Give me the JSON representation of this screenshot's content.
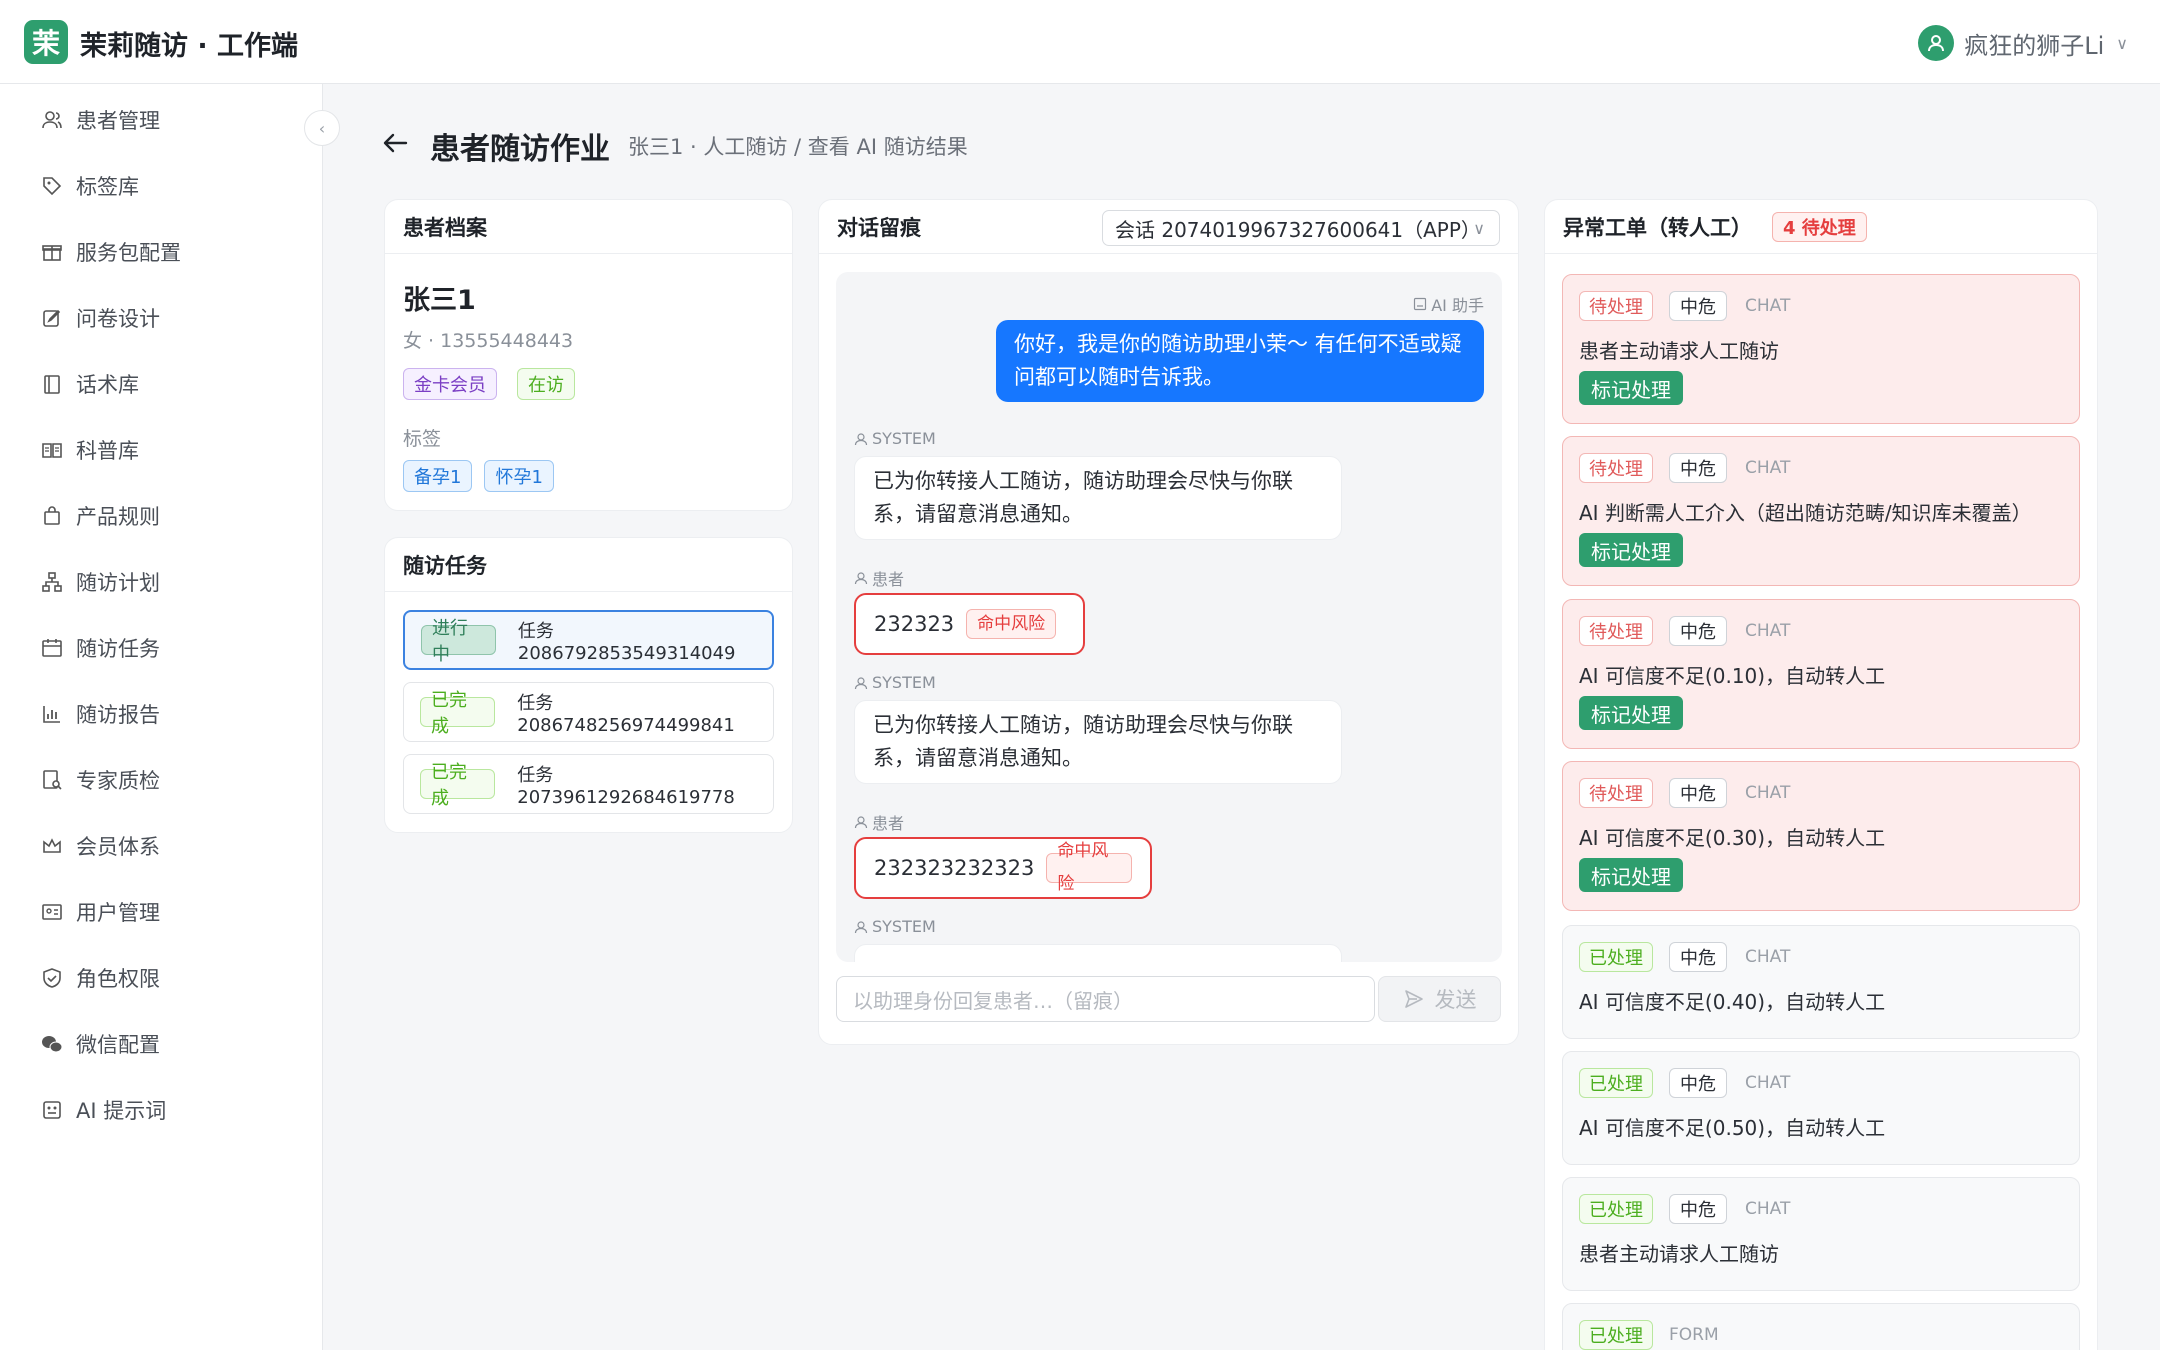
{
  "app": {
    "logo_char": "茉",
    "title": "茉莉随访 · 工作端",
    "user_name": "疯狂的狮子Li",
    "brand_color": "#2e9e6e"
  },
  "sidebar": {
    "items": [
      {
        "label": "患者管理",
        "icon": "users-icon"
      },
      {
        "label": "标签库",
        "icon": "tag-icon"
      },
      {
        "label": "服务包配置",
        "icon": "gift-icon"
      },
      {
        "label": "问卷设计",
        "icon": "edit-icon"
      },
      {
        "label": "话术库",
        "icon": "book-icon"
      },
      {
        "label": "科普库",
        "icon": "open-book-icon"
      },
      {
        "label": "产品规则",
        "icon": "bag-icon"
      },
      {
        "label": "随访计划",
        "icon": "org-chart-icon"
      },
      {
        "label": "随访任务",
        "icon": "calendar-icon"
      },
      {
        "label": "随访报告",
        "icon": "bar-chart-icon"
      },
      {
        "label": "专家质检",
        "icon": "audit-icon"
      },
      {
        "label": "会员体系",
        "icon": "crown-icon"
      },
      {
        "label": "用户管理",
        "icon": "id-card-icon"
      },
      {
        "label": "角色权限",
        "icon": "shield-icon"
      },
      {
        "label": "微信配置",
        "icon": "wechat-icon"
      },
      {
        "label": "AI 提示词",
        "icon": "robot-icon"
      }
    ]
  },
  "page": {
    "title": "患者随访作业",
    "breadcrumb": "张三1 · 人工随访 / 查看 AI 随访结果"
  },
  "patient": {
    "section_title": "患者档案",
    "name": "张三1",
    "info": "女 · 13555448443",
    "badges": [
      "金卡会员",
      "在访"
    ],
    "tags_label": "标签",
    "tags": [
      "备孕1",
      "怀孕1"
    ]
  },
  "tasks": {
    "section_title": "随访任务",
    "items": [
      {
        "status": "进行中",
        "name": "任务 2086792853549314049",
        "active": true
      },
      {
        "status": "已完成",
        "name": "任务 2086748256974499841",
        "active": false
      },
      {
        "status": "已完成",
        "name": "任务 2073961292684619778",
        "active": false
      }
    ]
  },
  "chat": {
    "section_title": "对话留痕",
    "session": "会话 2074019967327600641（APP）",
    "messages": [
      {
        "sender": "AI 助手",
        "type": "ai",
        "text1": "你好，我是你的随访助理小茉～ 有任何不适或疑",
        "text2": "问都可以随时告诉我。"
      },
      {
        "sender": "SYSTEM",
        "type": "system",
        "text1": "已为你转接人工随访，随访助理会尽快与你联",
        "text2": "系，请留意消息通知。"
      },
      {
        "sender": "患者",
        "type": "patient",
        "text": "232323",
        "risk": "命中风险"
      },
      {
        "sender": "SYSTEM",
        "type": "system",
        "text1": "已为你转接人工随访，随访助理会尽快与你联",
        "text2": "系，请留意消息通知。"
      },
      {
        "sender": "患者",
        "type": "patient",
        "text": "232323232323",
        "risk": "命中风险"
      },
      {
        "sender": "SYSTEM",
        "type": "system",
        "text1": "",
        "text2": ""
      }
    ],
    "input_placeholder": "以助理身份回复患者…（留痕）",
    "send_label": "发送"
  },
  "tickets": {
    "section_title": "异常工单（转人工）",
    "pending_count": "4 待处理",
    "mark_label": "标记处理",
    "items": [
      {
        "status": "待处理",
        "level": "中危",
        "channel": "CHAT",
        "desc": "患者主动请求人工随访",
        "pending": true
      },
      {
        "status": "待处理",
        "level": "中危",
        "channel": "CHAT",
        "desc": "AI 判断需人工介入（超出随访范畴/知识库未覆盖）",
        "pending": true
      },
      {
        "status": "待处理",
        "level": "中危",
        "channel": "CHAT",
        "desc": "AI 可信度不足(0.10)，自动转人工",
        "pending": true
      },
      {
        "status": "待处理",
        "level": "中危",
        "channel": "CHAT",
        "desc": "AI 可信度不足(0.30)，自动转人工",
        "pending": true
      },
      {
        "status": "已处理",
        "level": "中危",
        "channel": "CHAT",
        "desc": "AI 可信度不足(0.40)，自动转人工",
        "pending": false
      },
      {
        "status": "已处理",
        "level": "中危",
        "channel": "CHAT",
        "desc": "AI 可信度不足(0.50)，自动转人工",
        "pending": false
      },
      {
        "status": "已处理",
        "level": "中危",
        "channel": "CHAT",
        "desc": "患者主动请求人工随访",
        "pending": false
      },
      {
        "status": "已处理",
        "level": "",
        "channel": "FORM",
        "desc": "",
        "pending": false
      }
    ]
  }
}
